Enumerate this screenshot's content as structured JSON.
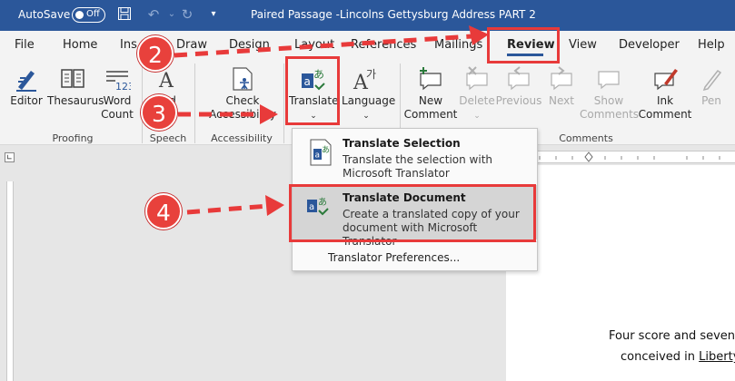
{
  "titlebar": {
    "autosave_label": "AutoSave",
    "autosave_state": "Off",
    "document_title": "Paired Passage -Lincolns Gettysburg Address PART 2"
  },
  "tabs": [
    "File",
    "Home",
    "Ins",
    "Draw",
    "Design",
    "Layout",
    "References",
    "Mailings",
    "Review",
    "View",
    "Developer",
    "Help"
  ],
  "active_tab": "Review",
  "ribbon": {
    "proofing": {
      "editor": "Editor",
      "thesaurus": "Thesaurus",
      "word_count_1": "Word",
      "word_count_2": "Count",
      "group": "Proofing"
    },
    "speech": {
      "read_aloud_1": "d",
      "group": "Speech"
    },
    "accessibility": {
      "check_1": "Check",
      "check_2": "Accessibility",
      "group": "Accessibility"
    },
    "language": {
      "translate": "Translate",
      "language": "Language"
    },
    "comments": {
      "new_1": "New",
      "new_2": "Comment",
      "delete": "Delete",
      "previous": "Previous",
      "next": "Next",
      "show_1": "Show",
      "show_2": "Comments",
      "ink_1": "Ink",
      "ink_2": "Comment",
      "pen": "Pen",
      "group": "Comments"
    }
  },
  "dropdown": {
    "item1_title": "Translate Selection",
    "item1_desc": "Translate the selection with Microsoft Translator",
    "item2_title": "Translate Document",
    "item2_desc": "Create a translated copy of your document with Microsoft Translator",
    "preferences": "Translator Preferences..."
  },
  "document": {
    "line1": "Four score and seven",
    "line2_a": "conceived in ",
    "line2_b": "Liberty"
  },
  "annotations": {
    "step2": "2",
    "step3": "3",
    "step4": "4"
  },
  "colors": {
    "titlebar": "#2b579a",
    "annotation_red": "#e83a3a"
  }
}
